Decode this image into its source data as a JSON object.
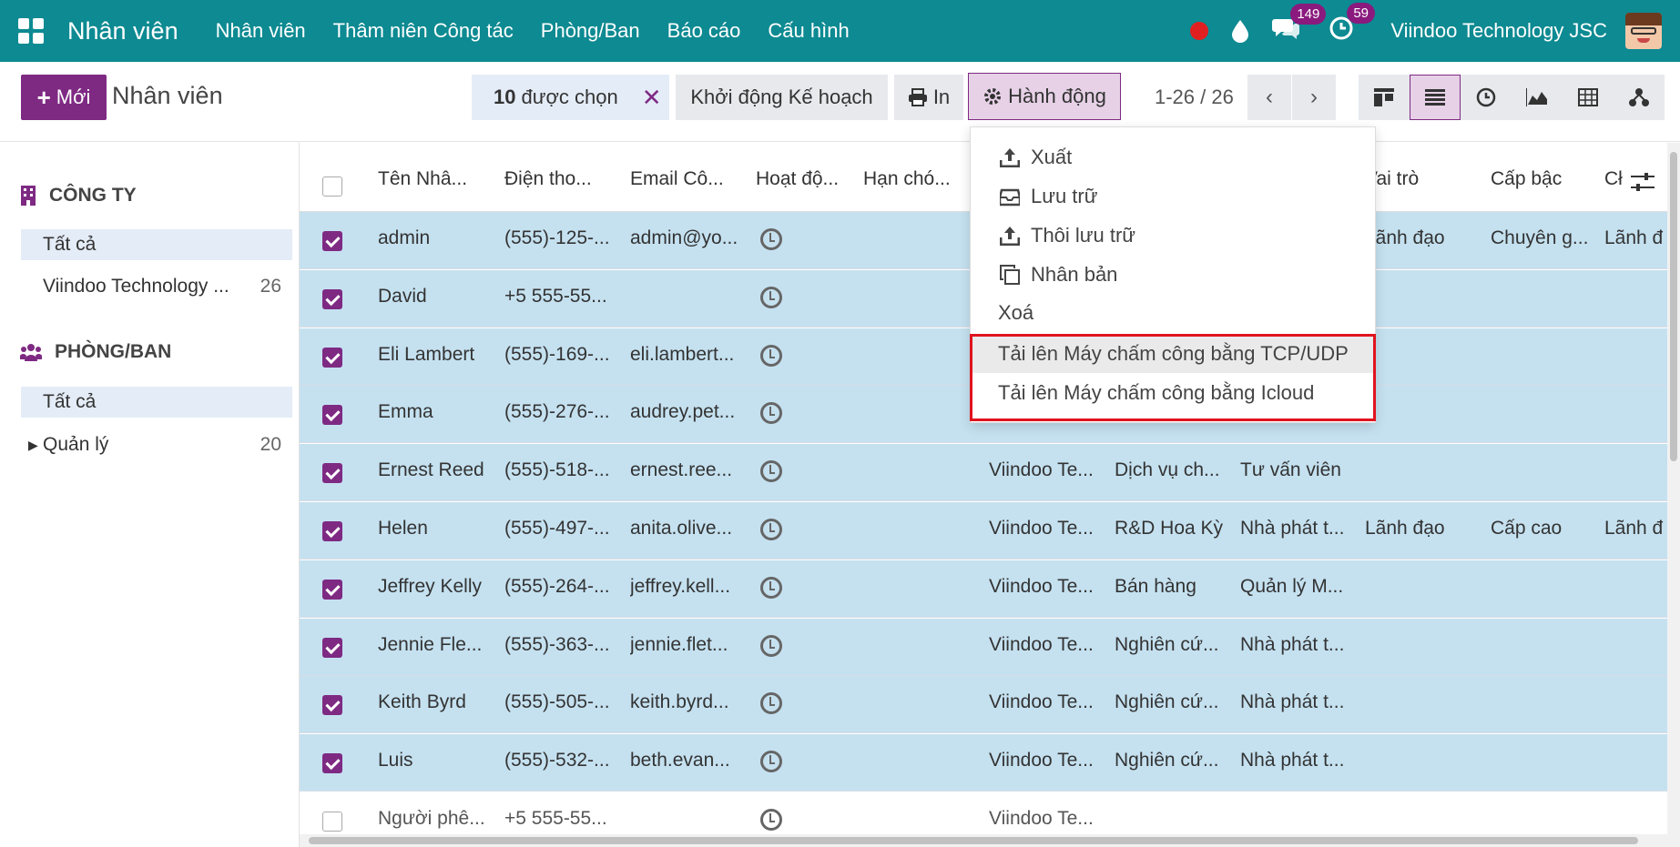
{
  "navbar": {
    "app_title": "Nhân viên",
    "menu": [
      "Nhân viên",
      "Thâm niên Công tác",
      "Phòng/Ban",
      "Báo cáo",
      "Cấu hình"
    ],
    "messages_count": "149",
    "activities_count": "59",
    "company": "Viindoo Technology JSC"
  },
  "control": {
    "new_label": "Mới",
    "breadcrumb": "Nhân viên",
    "selected_count": "10",
    "selected_label": "được chọn",
    "start_plan_label": "Khởi động Kế hoạch",
    "print_label": "In",
    "action_label": "Hành động",
    "pager": "1-26 / 26"
  },
  "sidebar": {
    "company_header": "CÔNG TY",
    "company_items": [
      {
        "label": "Tất cả",
        "count": ""
      },
      {
        "label": "Viindoo Technology ...",
        "count": "26"
      }
    ],
    "department_header": "PHÒNG/BAN",
    "department_items": [
      {
        "label": "Tất cả",
        "count": ""
      },
      {
        "label": "Quản lý",
        "count": "20"
      }
    ]
  },
  "table": {
    "columns": [
      "Tên Nhâ...",
      "Điện tho...",
      "Email Cô...",
      "Hoạt độ...",
      "Hạn chó...",
      "Vai trò",
      "Cấp bậc",
      "Cł"
    ],
    "rows": [
      {
        "name": "admin",
        "phone": "(555)-125-...",
        "email": "admin@yo...",
        "company": "",
        "dept": "",
        "job": "",
        "role": "Lãnh đạo",
        "level": "Chuyên g...",
        "extra": "Lãnh đ",
        "selected": true
      },
      {
        "name": "David",
        "phone": "+5 555-55...",
        "email": "",
        "company": "",
        "dept": "",
        "job": "",
        "role": "",
        "level": "",
        "extra": "",
        "selected": true
      },
      {
        "name": "Eli Lambert",
        "phone": "(555)-169-...",
        "email": "eli.lambert...",
        "company": "",
        "dept": "",
        "job": "",
        "role": "",
        "level": "",
        "extra": "",
        "selected": true
      },
      {
        "name": "Emma",
        "phone": "(555)-276-...",
        "email": "audrey.pet...",
        "company": "",
        "dept": "",
        "job": "",
        "role": "",
        "level": "",
        "extra": "",
        "selected": true
      },
      {
        "name": "Ernest Reed",
        "phone": "(555)-518-...",
        "email": "ernest.ree...",
        "company": "Viindoo Te...",
        "dept": "Dịch vụ ch...",
        "job": "Tư vấn viên",
        "role": "",
        "level": "",
        "extra": "",
        "selected": true
      },
      {
        "name": "Helen",
        "phone": "(555)-497-...",
        "email": "anita.olive...",
        "company": "Viindoo Te...",
        "dept": "R&D Hoa Kỳ",
        "job": "Nhà phát t...",
        "role": "Lãnh đạo",
        "level": "Cấp cao",
        "extra": "Lãnh đ",
        "selected": true
      },
      {
        "name": "Jeffrey Kelly",
        "phone": "(555)-264-...",
        "email": "jeffrey.kell...",
        "company": "Viindoo Te...",
        "dept": "Bán hàng",
        "job": "Quản lý M...",
        "role": "",
        "level": "",
        "extra": "",
        "selected": true
      },
      {
        "name": "Jennie Fle...",
        "phone": "(555)-363-...",
        "email": "jennie.flet...",
        "company": "Viindoo Te...",
        "dept": "Nghiên cứ...",
        "job": "Nhà phát t...",
        "role": "",
        "level": "",
        "extra": "",
        "selected": true
      },
      {
        "name": "Keith Byrd",
        "phone": "(555)-505-...",
        "email": "keith.byrd...",
        "company": "Viindoo Te...",
        "dept": "Nghiên cứ...",
        "job": "Nhà phát t...",
        "role": "",
        "level": "",
        "extra": "",
        "selected": true
      },
      {
        "name": "Luis",
        "phone": "(555)-532-...",
        "email": "beth.evan...",
        "company": "Viindoo Te...",
        "dept": "Nghiên cứ...",
        "job": "Nhà phát t...",
        "role": "",
        "level": "",
        "extra": "",
        "selected": true
      },
      {
        "name": "Người phê...",
        "phone": "+5 555-55...",
        "email": "",
        "company": "Viindoo Te...",
        "dept": "",
        "job": "",
        "role": "",
        "level": "",
        "extra": "",
        "selected": false
      }
    ]
  },
  "action_menu": {
    "items": [
      "Xuất",
      "Lưu trữ",
      "Thôi lưu trữ",
      "Nhân bản",
      "Xoá",
      "Tải lên Máy chấm công bằng TCP/UDP",
      "Tải lên Máy chấm công bằng Icloud"
    ]
  },
  "colors": {
    "navbar": "#0d8a92",
    "primary": "#7e2a83",
    "selected_row": "#c5e1f0",
    "highlight": "#e0141e"
  }
}
